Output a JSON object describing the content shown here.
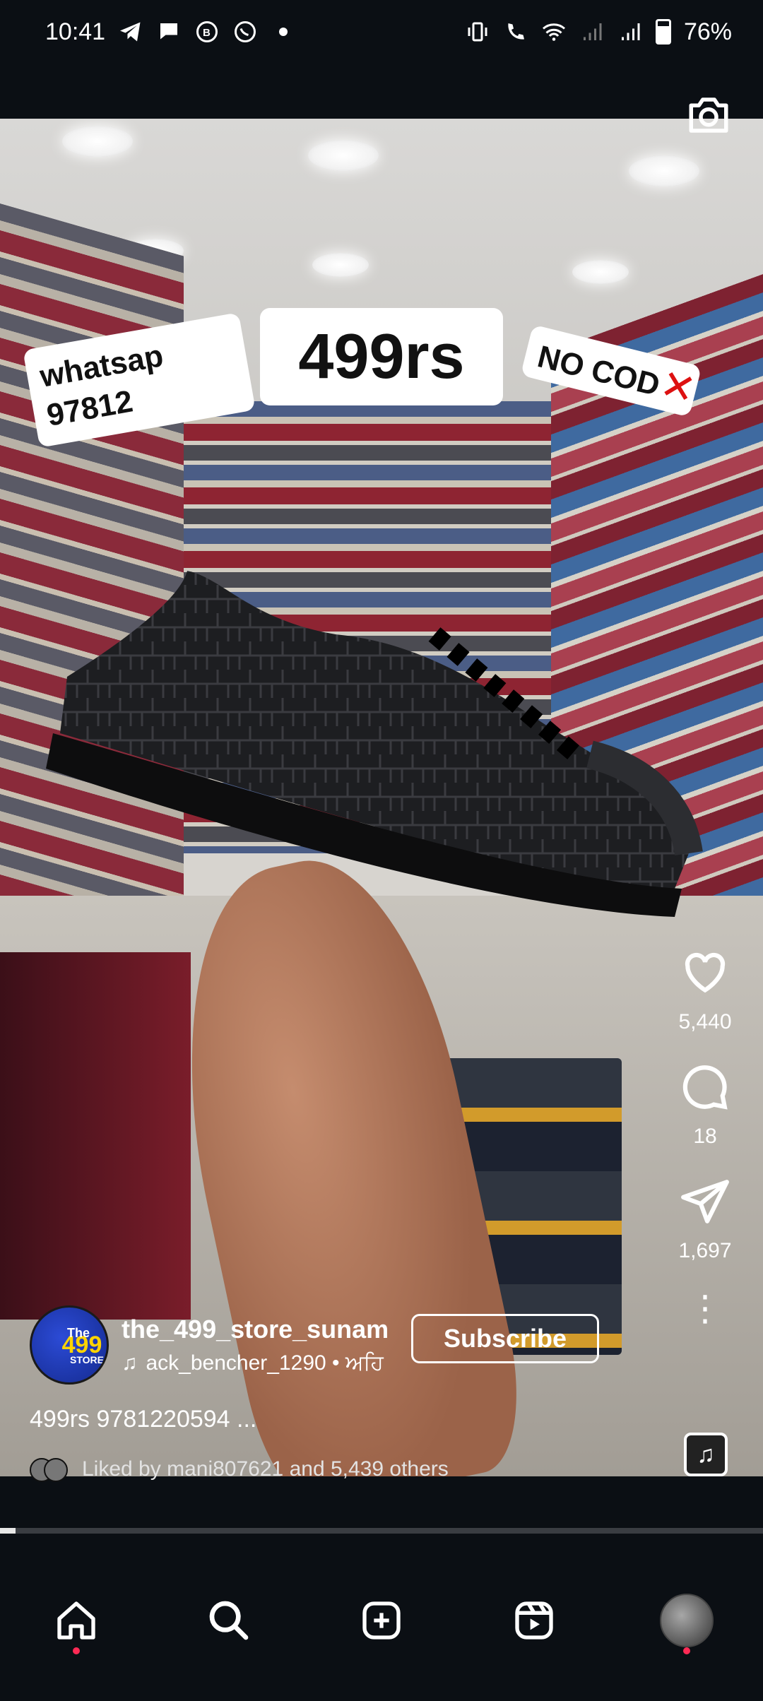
{
  "status_bar": {
    "time": "10:41",
    "battery": "76%",
    "left_icons": [
      "telegram-icon",
      "chat-bubble-icon",
      "whatsapp-business-icon",
      "whatsapp-icon",
      "dot-icon"
    ],
    "right_icons": [
      "vibrate-icon",
      "wifi-calling-icon",
      "wifi-icon",
      "signal-icon",
      "signal-icon",
      "battery-icon"
    ]
  },
  "stickers": {
    "whatsapp": "whatsap\n97812",
    "price": "499rs",
    "no_cod": "NO COD"
  },
  "actions": {
    "likes": "5,440",
    "comments": "18",
    "shares": "1,697"
  },
  "account": {
    "username": "the_499_store_sunam",
    "avatar_text": "The",
    "avatar_number": "499",
    "avatar_sub": "STORE",
    "audio": "ack_bencher_1290 • ਅਹਿ",
    "subscribe_label": "Subscribe"
  },
  "caption": "499rs 9781220594 ...",
  "liked_by": {
    "prefix": "Liked by",
    "user": "mani807621",
    "middle": "and",
    "others": "5,439 others"
  },
  "progress": 0.02,
  "colors": {
    "background": "#0b0f14",
    "notification_dot": "#ff2a55",
    "no_cod_x": "#d11111"
  },
  "nav": [
    "home-icon",
    "search-icon",
    "create-icon",
    "reels-icon",
    "profile-avatar"
  ]
}
